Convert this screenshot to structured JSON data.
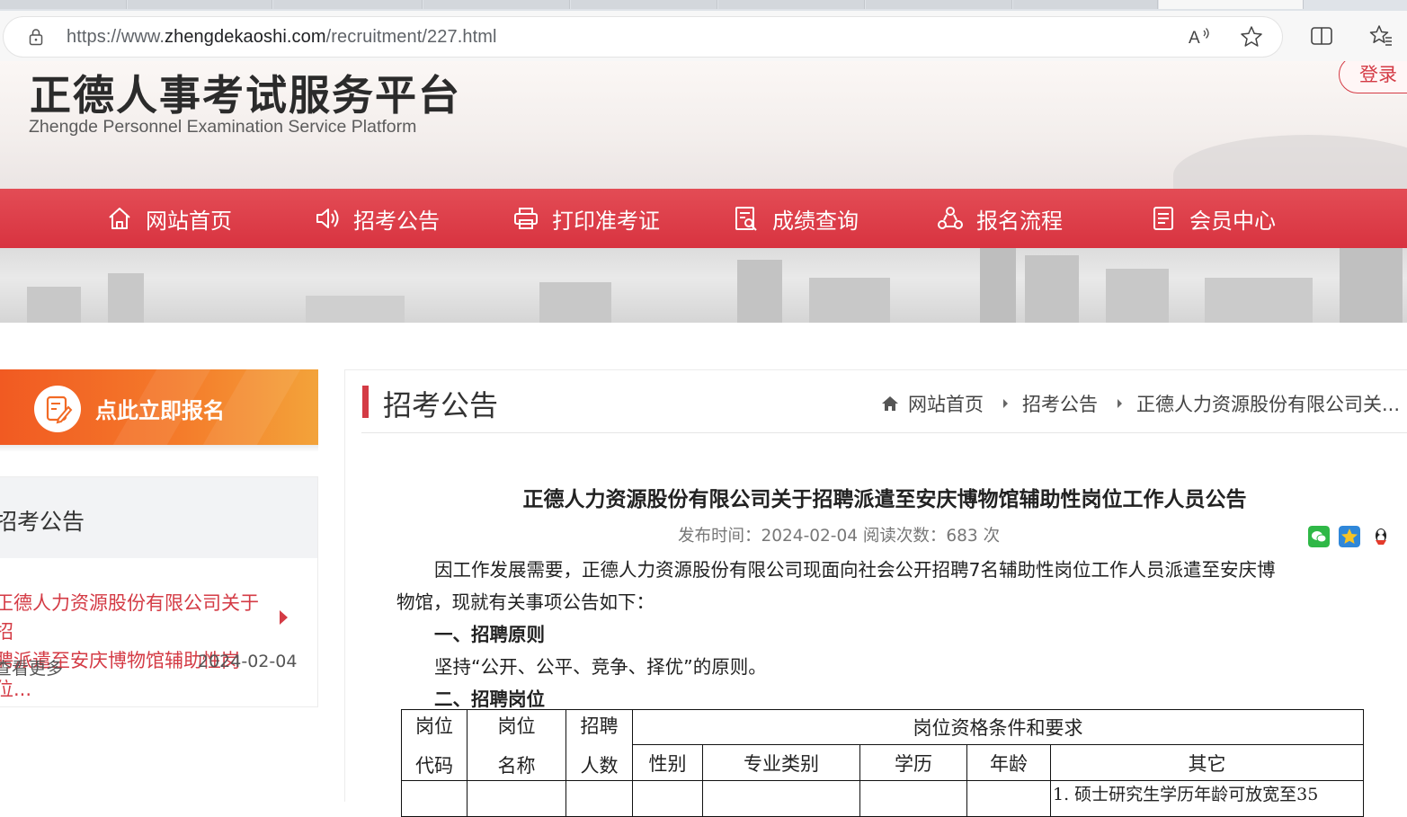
{
  "browser": {
    "url_prefix": "https://www.",
    "url_domain": "zhengdekaoshi.com",
    "url_path": "/recruitment/227.html",
    "icons": [
      "lock-icon",
      "read-aloud-icon",
      "favorite-star-icon",
      "split-screen-icon",
      "favorites-icon"
    ]
  },
  "header": {
    "title": "正德人事考试服务平台",
    "subtitle": "Zhengde Personnel Examination Service Platform",
    "login": "登录"
  },
  "nav": [
    {
      "label": "网站首页",
      "icon": "home-icon"
    },
    {
      "label": "招考公告",
      "icon": "speaker-icon"
    },
    {
      "label": "打印准考证",
      "icon": "printer-icon"
    },
    {
      "label": "成绩查询",
      "icon": "score-search-icon"
    },
    {
      "label": "报名流程",
      "icon": "process-icon"
    },
    {
      "label": "会员中心",
      "icon": "member-icon"
    }
  ],
  "sidebar": {
    "register": "点此立即报名",
    "section_title": "招考公告",
    "link_line1": "正德人力资源股份有限公司关于招",
    "link_line2": "聘派遣至安庆博物馆辅助性岗位...",
    "more": "查看更多",
    "date": "2024-02-04"
  },
  "main": {
    "title": "招考公告",
    "breadcrumb": [
      "网站首页",
      "招考公告",
      "正德人力资源股份有限公司关..."
    ],
    "article_title": "正德人力资源股份有限公司关于招聘派遣至安庆博物馆辅助性岗位工作人员公告",
    "meta": "发布时间：2024-02-04   阅读次数：683 次",
    "share_icons": [
      "wechat-share-icon",
      "qzone-share-icon",
      "qq-share-icon"
    ],
    "intro_line1": "因工作发展需要，正德人力资源股份有限公司现面向社会公开招聘7名辅助性岗位工作人员派遣至安庆博",
    "intro_line2": "物馆，现就有关事项公告如下：",
    "section1": "一、招聘原则",
    "principle": "坚持“公开、公平、竞争、择优”的原则。",
    "section2": "二、招聘岗位"
  },
  "table": {
    "h_code_1": "岗位",
    "h_code_2": "代码",
    "h_name_1": "岗位",
    "h_name_2": "名称",
    "h_num_1": "招聘",
    "h_num_2": "人数",
    "h_req": "岗位资格条件和要求",
    "h_gender": "性别",
    "h_major": "专业类别",
    "h_edu": "学历",
    "h_age": "年龄",
    "h_other": "其它",
    "row1_other": "1. 硕士研究生学历年龄可放宽至35"
  }
}
